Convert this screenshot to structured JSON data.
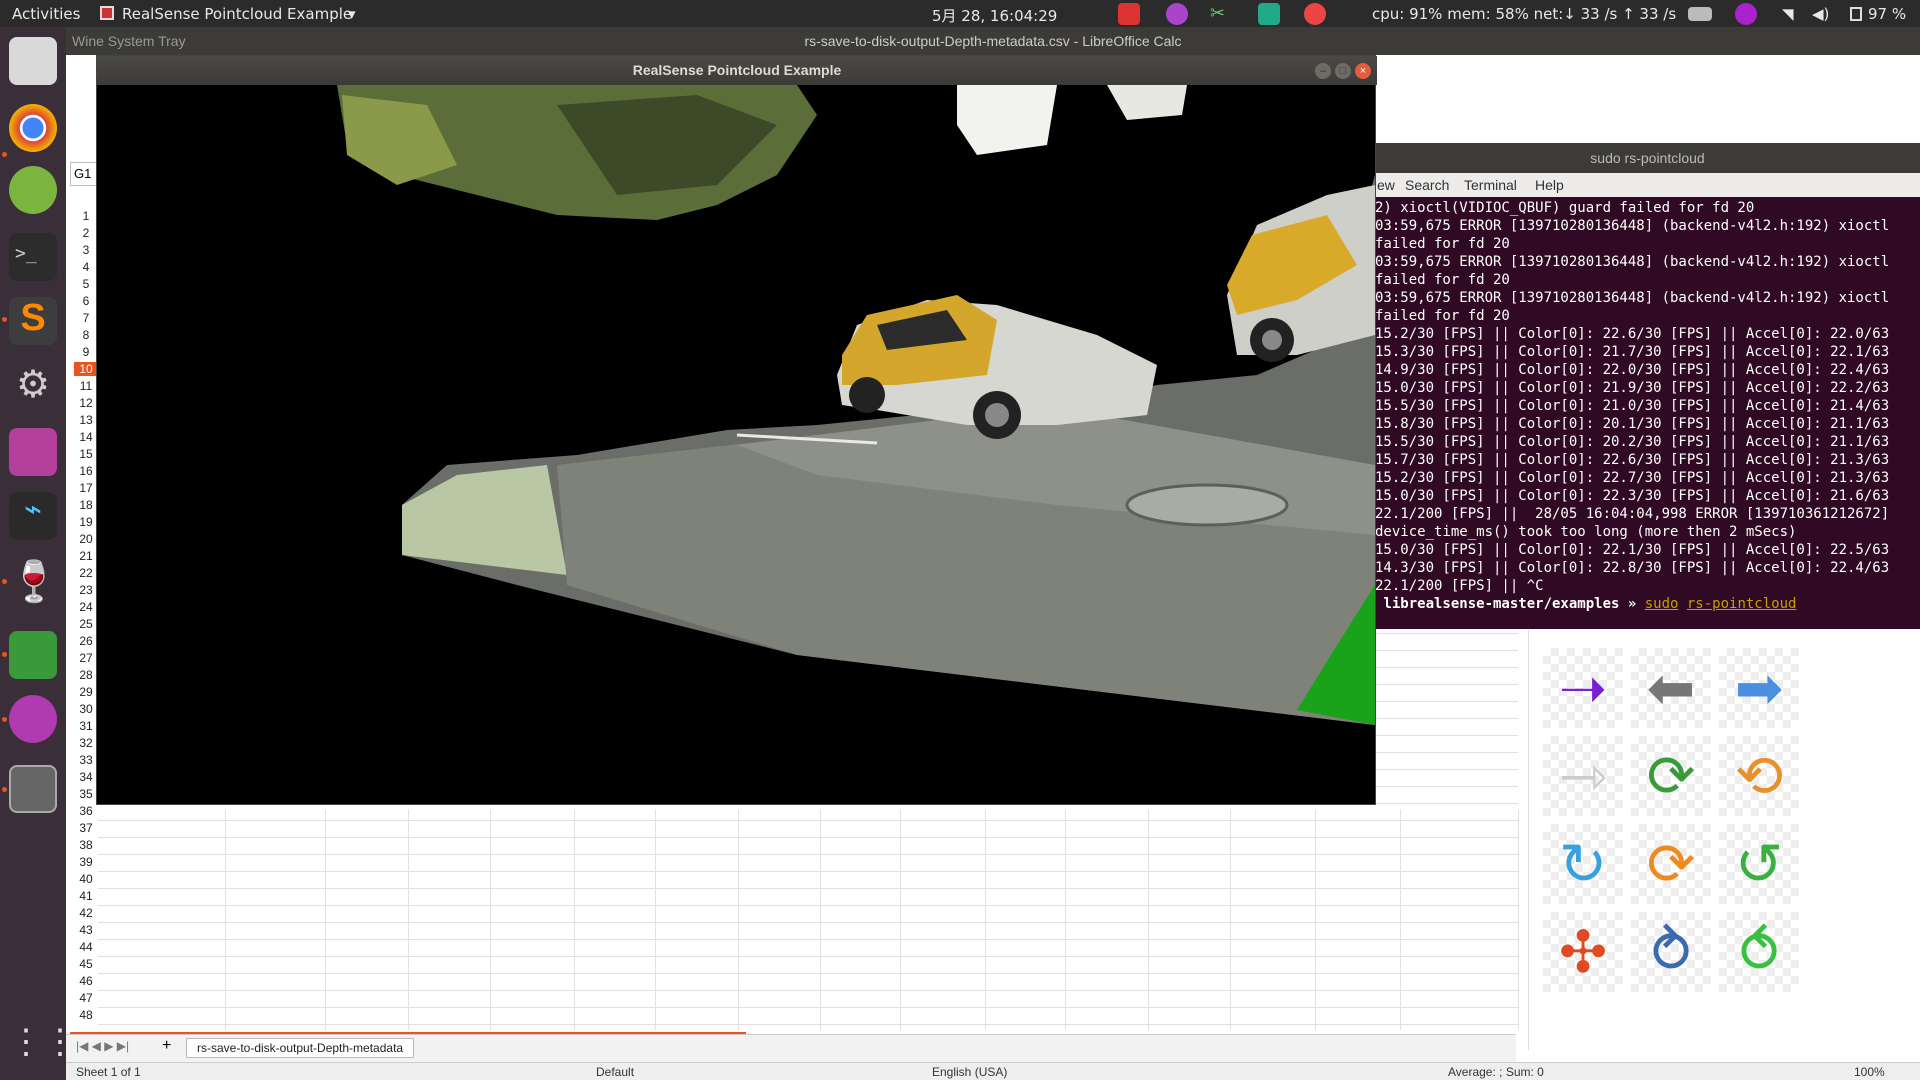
{
  "topbar": {
    "activities": "Activities",
    "app_menu": "RealSense Pointcloud Example",
    "clock": "5月 28, 16:04:29",
    "sysmon": "cpu: 91% mem: 58% net:↓  33 /s ↑  33 /s",
    "battery": "97 %"
  },
  "calc": {
    "window_title": "rs-save-to-disk-output-Depth-metadata.csv - LibreOffice Calc",
    "wine_tab": "Wine System Tray",
    "name_box": "G1",
    "sheet_tab": "rs-save-to-disk-output-Depth-metadata",
    "add_sheet": "+",
    "status": {
      "sheet": "Sheet 1 of 1",
      "style": "Default",
      "lang": "English (USA)",
      "summary": "Average: ; Sum: 0",
      "zoom": "100%"
    },
    "row_numbers": [
      "1",
      "2",
      "3",
      "4",
      "5",
      "6",
      "7",
      "8",
      "9",
      "10",
      "11",
      "12",
      "13",
      "14",
      "15",
      "16",
      "17",
      "18",
      "19",
      "20",
      "21",
      "22",
      "23",
      "24",
      "25",
      "26",
      "27",
      "28",
      "29",
      "30",
      "31",
      "32",
      "33",
      "34",
      "35",
      "36",
      "37",
      "38",
      "39",
      "40",
      "41",
      "42",
      "43",
      "44",
      "45",
      "46",
      "47",
      "48"
    ]
  },
  "terminal": {
    "title": "sudo rs-pointcloud",
    "menu": [
      "ew",
      "Search",
      "Terminal",
      "Help"
    ],
    "lines": [
      "2) xioctl(VIDIOC_QBUF) guard failed for fd 20",
      "03:59,675 ERROR [139710280136448] (backend-v4l2.h:192) xioctl",
      "failed for fd 20",
      "03:59,675 ERROR [139710280136448] (backend-v4l2.h:192) xioctl",
      "failed for fd 20",
      "03:59,675 ERROR [139710280136448] (backend-v4l2.h:192) xioctl",
      "failed for fd 20",
      "15.2/30 [FPS] || Color[0]: 22.6/30 [FPS] || Accel[0]: 22.0/63",
      "15.3/30 [FPS] || Color[0]: 21.7/30 [FPS] || Accel[0]: 22.1/63",
      "14.9/30 [FPS] || Color[0]: 22.0/30 [FPS] || Accel[0]: 22.4/63",
      "15.0/30 [FPS] || Color[0]: 21.9/30 [FPS] || Accel[0]: 22.2/63",
      "15.5/30 [FPS] || Color[0]: 21.0/30 [FPS] || Accel[0]: 21.4/63",
      "15.8/30 [FPS] || Color[0]: 20.1/30 [FPS] || Accel[0]: 21.1/63",
      "15.5/30 [FPS] || Color[0]: 20.2/30 [FPS] || Accel[0]: 21.1/63",
      "15.7/30 [FPS] || Color[0]: 22.6/30 [FPS] || Accel[0]: 21.3/63",
      "15.2/30 [FPS] || Color[0]: 22.7/30 [FPS] || Accel[0]: 21.3/63",
      "15.0/30 [FPS] || Color[0]: 22.3/30 [FPS] || Accel[0]: 21.6/63",
      "22.1/200 [FPS] ||  28/05 16:04:04,998 ERROR [139710361212672]",
      "device_time_ms() took too long (more then 2 mSecs)",
      "15.0/30 [FPS] || Color[0]: 22.1/30 [FPS] || Accel[0]: 22.5/63",
      "14.3/30 [FPS] || Color[0]: 22.8/30 [FPS] || Accel[0]: 22.4/63",
      "22.1/200 [FPS] || ^C"
    ],
    "prompt": " librealsense-master/examples » ",
    "cmd_sudo": "sudo",
    "cmd_name": "rs-pointcloud"
  },
  "pointcloud": {
    "title": "RealSense Pointcloud Example"
  },
  "colors": {
    "accent": "#e95420",
    "terminal_bg": "#300a24",
    "dock_bg": "#3a2f38"
  }
}
